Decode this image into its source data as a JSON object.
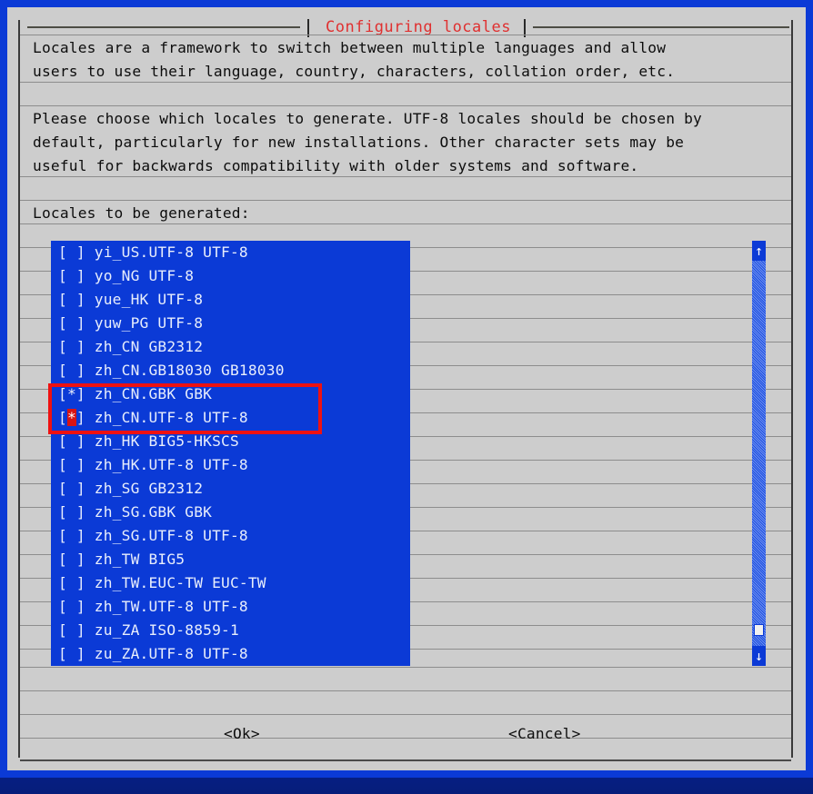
{
  "window": {
    "title": "Configuring locales",
    "title_color": "#e03030",
    "dialog_bg": "#cdcdcd",
    "accent_blue": "#0b3ad6",
    "annotation_color": "#ee1111"
  },
  "body": {
    "paragraph1": [
      "Locales are a framework to switch between multiple languages and allow",
      "users to use their language, country, characters, collation order, etc."
    ],
    "paragraph2": [
      "Please choose which locales to generate. UTF-8 locales should be chosen by",
      "default, particularly for new installations. Other character sets may be",
      "useful for backwards compatibility with older systems and software."
    ],
    "list_label": "Locales to be generated:"
  },
  "locale_list": [
    {
      "checkbox": "[ ]",
      "label": "yi_US.UTF-8 UTF-8",
      "checked": false,
      "cursor": false
    },
    {
      "checkbox": "[ ]",
      "label": "yo_NG UTF-8",
      "checked": false,
      "cursor": false
    },
    {
      "checkbox": "[ ]",
      "label": "yue_HK UTF-8",
      "checked": false,
      "cursor": false
    },
    {
      "checkbox": "[ ]",
      "label": "yuw_PG UTF-8",
      "checked": false,
      "cursor": false
    },
    {
      "checkbox": "[ ]",
      "label": "zh_CN GB2312",
      "checked": false,
      "cursor": false
    },
    {
      "checkbox": "[ ]",
      "label": "zh_CN.GB18030 GB18030",
      "checked": false,
      "cursor": false
    },
    {
      "checkbox": "[*]",
      "label": "zh_CN.GBK GBK",
      "checked": true,
      "cursor": false
    },
    {
      "checkbox": "[*]",
      "label": "zh_CN.UTF-8 UTF-8",
      "checked": true,
      "cursor": true
    },
    {
      "checkbox": "[ ]",
      "label": "zh_HK BIG5-HKSCS",
      "checked": false,
      "cursor": false
    },
    {
      "checkbox": "[ ]",
      "label": "zh_HK.UTF-8 UTF-8",
      "checked": false,
      "cursor": false
    },
    {
      "checkbox": "[ ]",
      "label": "zh_SG GB2312",
      "checked": false,
      "cursor": false
    },
    {
      "checkbox": "[ ]",
      "label": "zh_SG.GBK GBK",
      "checked": false,
      "cursor": false
    },
    {
      "checkbox": "[ ]",
      "label": "zh_SG.UTF-8 UTF-8",
      "checked": false,
      "cursor": false
    },
    {
      "checkbox": "[ ]",
      "label": "zh_TW BIG5",
      "checked": false,
      "cursor": false
    },
    {
      "checkbox": "[ ]",
      "label": "zh_TW.EUC-TW EUC-TW",
      "checked": false,
      "cursor": false
    },
    {
      "checkbox": "[ ]",
      "label": "zh_TW.UTF-8 UTF-8",
      "checked": false,
      "cursor": false
    },
    {
      "checkbox": "[ ]",
      "label": "zu_ZA ISO-8859-1",
      "checked": false,
      "cursor": false
    },
    {
      "checkbox": "[ ]",
      "label": "zu_ZA.UTF-8 UTF-8",
      "checked": false,
      "cursor": false
    }
  ],
  "scrollbar": {
    "up_arrow": "↑",
    "down_arrow": "↓",
    "thumb_position_percent": 92
  },
  "buttons": {
    "ok": "<Ok>",
    "cancel": "<Cancel>"
  }
}
